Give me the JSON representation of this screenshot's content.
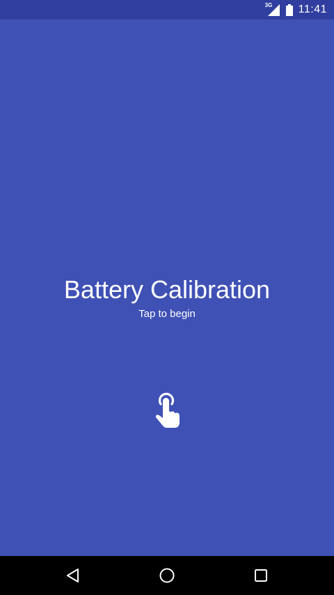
{
  "status_bar": {
    "network_type": "3G",
    "time": "11:41",
    "icons": [
      "signal-icon",
      "battery-icon"
    ]
  },
  "main": {
    "title": "Battery Calibration",
    "subtitle": "Tap to begin",
    "icon": "tap-hand-icon"
  },
  "nav_bar": {
    "buttons": [
      "back-icon",
      "home-icon",
      "recents-icon"
    ]
  },
  "colors": {
    "background": "#3f51b5",
    "status_bar": "#303f9f",
    "nav_bar": "#000000",
    "foreground": "#ffffff"
  }
}
